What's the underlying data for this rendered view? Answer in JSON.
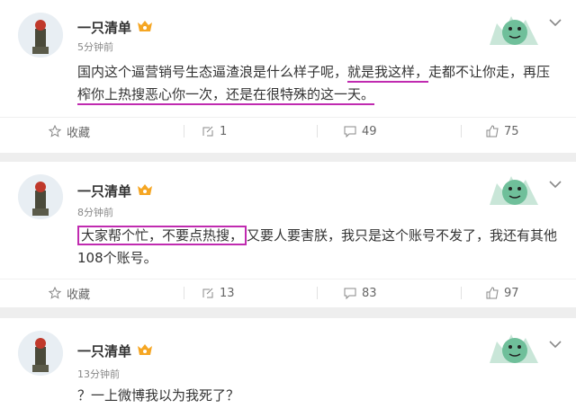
{
  "posts": [
    {
      "author": "一只清单",
      "time": "5分钟前",
      "text_parts": [
        "国内这个逼营销号生态逼渣浪是什么样子呢，",
        "就是我这样，",
        "走都不让你走，再压",
        "榨你上热搜恶心你一次，",
        "还是在很特殊的这一天。"
      ],
      "actions": {
        "favorite": "收藏",
        "repost": "1",
        "comment": "49",
        "like": "75"
      }
    },
    {
      "author": "一只清单",
      "time": "8分钟前",
      "text_parts": [
        "大家帮个忙，不要点热搜，",
        "又要人要害朕，我只是这个账号不发了，我还有其他",
        "108个账号。"
      ],
      "actions": {
        "favorite": "收藏",
        "repost": "13",
        "comment": "83",
        "like": "97"
      }
    },
    {
      "author": "一只清单",
      "time": "13分钟前",
      "text_parts": [
        "？一上微博我以为我死了？"
      ]
    }
  ],
  "colors": {
    "highlight": "#c02bb0",
    "vip": "#f5a623",
    "mascot": "#6fbf9a"
  },
  "icons": [
    "star-icon",
    "repost-icon",
    "comment-icon",
    "like-icon",
    "chevron-down-icon",
    "vip-badge-icon"
  ]
}
